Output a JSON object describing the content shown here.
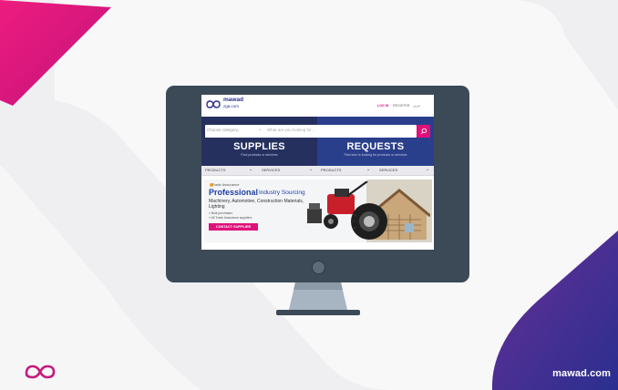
{
  "site": {
    "brand_word": "mawad",
    "brand_sub": "zga.com",
    "footer_url": "mawad.com",
    "accent_color": "#e0107a",
    "primary_color": "#2a3f8c"
  },
  "header": {
    "login_label": "LOG IN",
    "register_label": "REGISTER",
    "language_label": "عربي"
  },
  "search": {
    "category_placeholder": "Choose category...",
    "input_placeholder": "What are you looking for...",
    "button_icon": "search-icon"
  },
  "hero": {
    "supplies_title": "SUPPLIES",
    "supplies_sub": "Find products or services",
    "requests_title": "REQUESTS",
    "requests_sub": "Find who is looking for products or services"
  },
  "nav": {
    "items": [
      {
        "label": "PRODUCTS"
      },
      {
        "label": "SERVICES"
      },
      {
        "label": "PRODUCTS"
      },
      {
        "label": "SERVICES"
      }
    ]
  },
  "banner": {
    "badge": "Trade Assurance",
    "title_strong": "Professional",
    "title_light": "Industry Sourcing",
    "subtitle": "Machinery, Automotive, Construction Materials, Lighting",
    "bullet_1": "» Bulk purchases",
    "bullet_2": "» All Trade Assurance suppliers",
    "cta_label": "CONTACT SUPPLIER"
  }
}
